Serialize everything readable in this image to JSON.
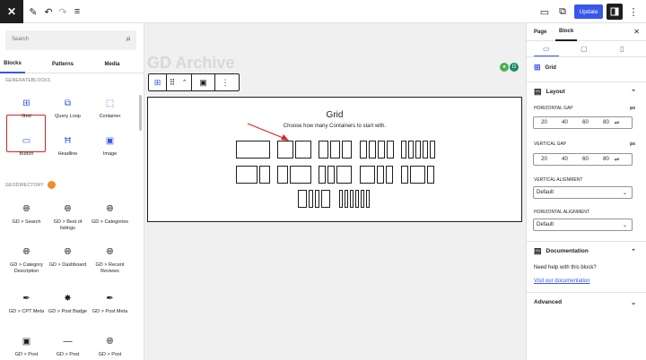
{
  "topbar": {
    "logo": "✕",
    "update_label": "Update"
  },
  "inserter": {
    "search_placeholder": "Search",
    "tabs": [
      "Blocks",
      "Patterns",
      "Media"
    ],
    "generateblocks_title": "GENERATEBLOCKS",
    "geodirectory_title": "GEODIRECTORY",
    "generate_blocks": [
      {
        "label": "Grid",
        "icon": "grid-icon"
      },
      {
        "label": "Query Loop",
        "icon": "query-loop-icon"
      },
      {
        "label": "Container",
        "icon": "container-icon"
      },
      {
        "label": "Button",
        "icon": "button-icon"
      },
      {
        "label": "Headline",
        "icon": "headline-icon"
      },
      {
        "label": "Image",
        "icon": "image-icon"
      }
    ],
    "geo_blocks": [
      {
        "label": "GD > Search"
      },
      {
        "label": "GD > Best of listings"
      },
      {
        "label": "GD > Categories"
      },
      {
        "label": "GD > Category Description"
      },
      {
        "label": "GD > Dashboard"
      },
      {
        "label": "GD > Recent Reviews"
      },
      {
        "label": "GD > CPT Meta"
      },
      {
        "label": "GD > Post Badge"
      },
      {
        "label": "GD > Post Meta"
      },
      {
        "label": "GD > Post"
      },
      {
        "label": "GD > Post"
      },
      {
        "label": "GD > Post"
      }
    ]
  },
  "canvas": {
    "page_title": "GD Archive",
    "grid_block": {
      "title": "Grid",
      "subtitle": "Choose how many Containers to start with.",
      "layouts": [
        [
          1
        ],
        [
          1,
          1
        ],
        [
          1,
          1,
          1
        ],
        [
          1,
          1,
          1,
          1
        ],
        [
          1,
          1,
          1,
          1,
          1
        ],
        [
          2,
          1
        ],
        [
          1,
          2
        ],
        [
          1,
          1,
          2
        ],
        [
          2,
          1,
          1
        ],
        [
          1,
          2,
          1
        ],
        [
          2,
          1,
          1,
          2
        ],
        [
          1,
          1,
          1,
          1,
          1,
          1
        ],
        [
          2,
          1,
          1,
          1,
          1
        ]
      ]
    }
  },
  "sidebar": {
    "tabs": [
      "Page",
      "Block"
    ],
    "block_name": "Grid",
    "layout": {
      "title": "Layout",
      "horizontal_gap_label": "HORIZONTAL GAP",
      "vertical_gap_label": "VERTICAL GAP",
      "unit": "px",
      "gap_values": [
        "20",
        "40",
        "60",
        "80"
      ],
      "vertical_alignment_label": "VERTICAL ALIGNMENT",
      "vertical_alignment_value": "Default",
      "horizontal_alignment_label": "HORIZONTAL ALIGNMENT",
      "horizontal_alignment_value": "Default"
    },
    "documentation": {
      "title": "Documentation",
      "help_text": "Need help with this block?",
      "link_text": "Visit our documentation"
    },
    "advanced_title": "Advanced"
  },
  "colors": {
    "accent": "#3858e9",
    "highlight": "#e02020"
  }
}
